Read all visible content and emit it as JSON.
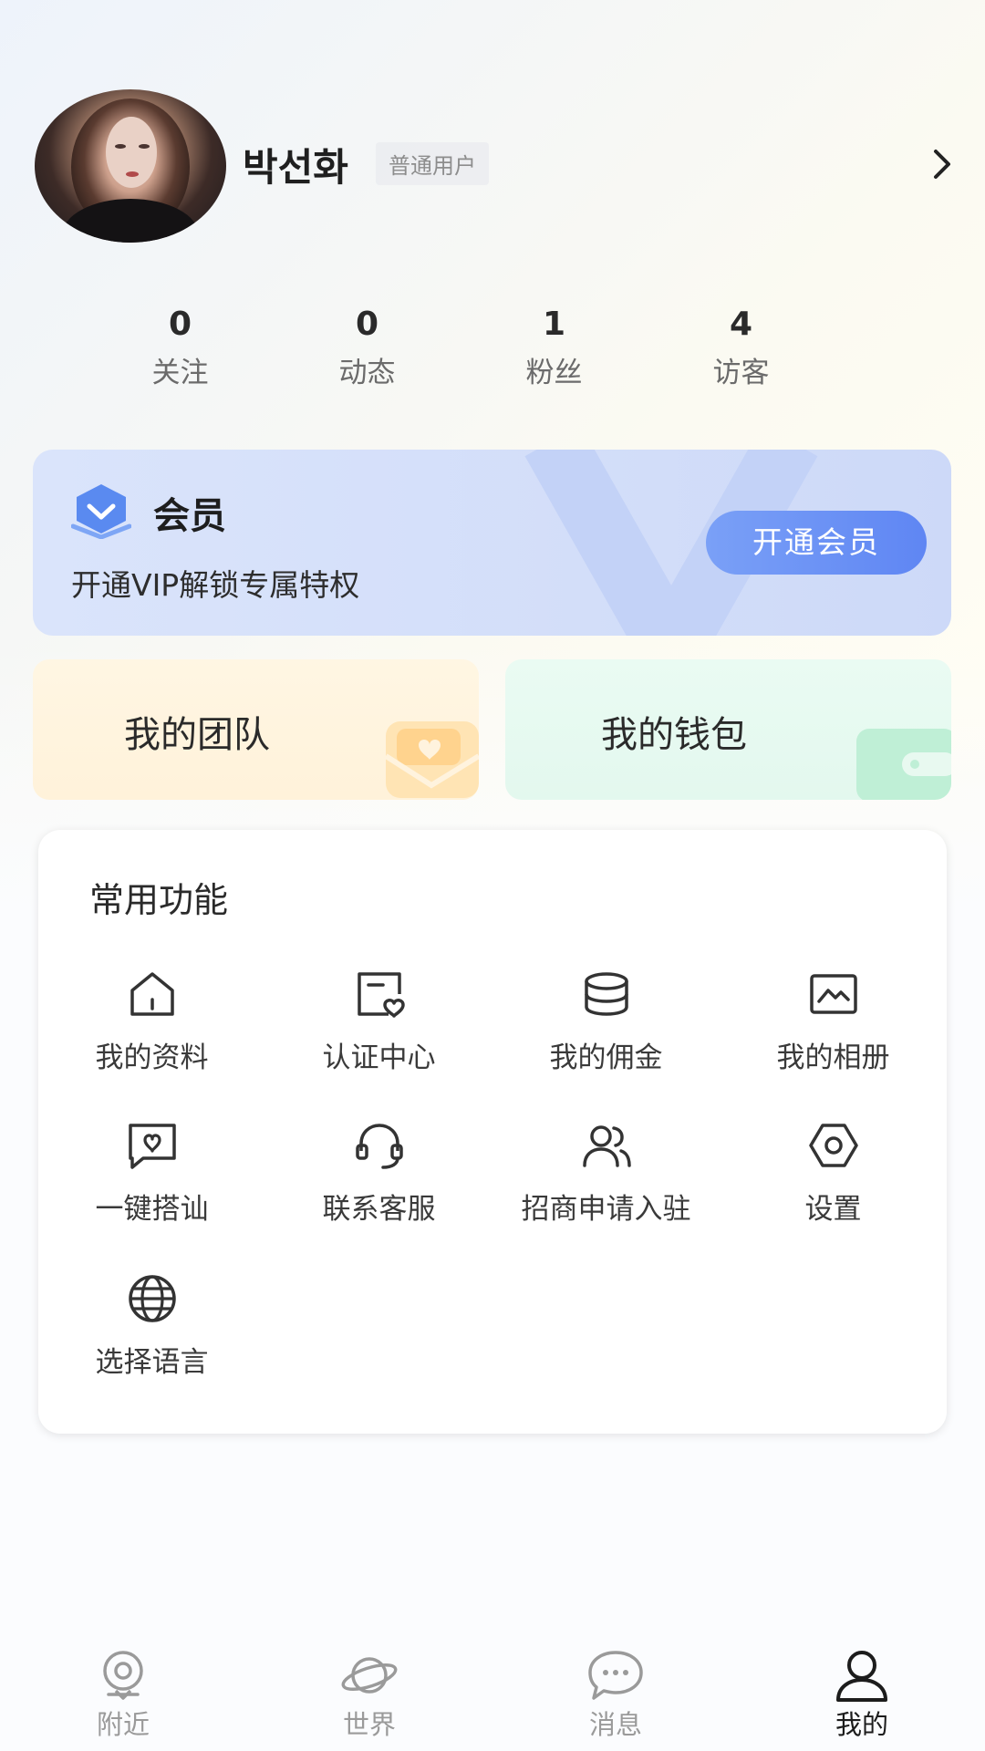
{
  "profile": {
    "username": "박선화",
    "role": "普通用户"
  },
  "stats": [
    {
      "value": "0",
      "label": "关注"
    },
    {
      "value": "0",
      "label": "动态"
    },
    {
      "value": "1",
      "label": "粉丝"
    },
    {
      "value": "4",
      "label": "访客"
    }
  ],
  "vip": {
    "title": "会员",
    "subtitle": "开通VIP解锁专属特权",
    "button": "开通会员"
  },
  "cards": {
    "team": "我的团队",
    "wallet": "我的钱包"
  },
  "functions": {
    "title": "常用功能",
    "items": [
      {
        "label": "我的资料",
        "icon": "home-icon"
      },
      {
        "label": "认证中心",
        "icon": "certificate-icon"
      },
      {
        "label": "我的佣金",
        "icon": "coins-icon"
      },
      {
        "label": "我的相册",
        "icon": "photo-album-icon"
      },
      {
        "label": "一键搭讪",
        "icon": "heart-message-icon"
      },
      {
        "label": "联系客服",
        "icon": "headset-icon"
      },
      {
        "label": "招商申请入驻",
        "icon": "users-icon"
      },
      {
        "label": "设置",
        "icon": "settings-icon"
      },
      {
        "label": "选择语言",
        "icon": "globe-icon"
      }
    ]
  },
  "nav": [
    {
      "label": "附近",
      "icon": "location-icon",
      "active": false
    },
    {
      "label": "世界",
      "icon": "planet-icon",
      "active": false
    },
    {
      "label": "消息",
      "icon": "chat-icon",
      "active": false
    },
    {
      "label": "我的",
      "icon": "user-icon",
      "active": true
    }
  ],
  "colors": {
    "accent": "#6289f4",
    "vip_card": "#d6e1fa",
    "team_card": "#fff4df",
    "wallet_card": "#e6f9f0"
  }
}
